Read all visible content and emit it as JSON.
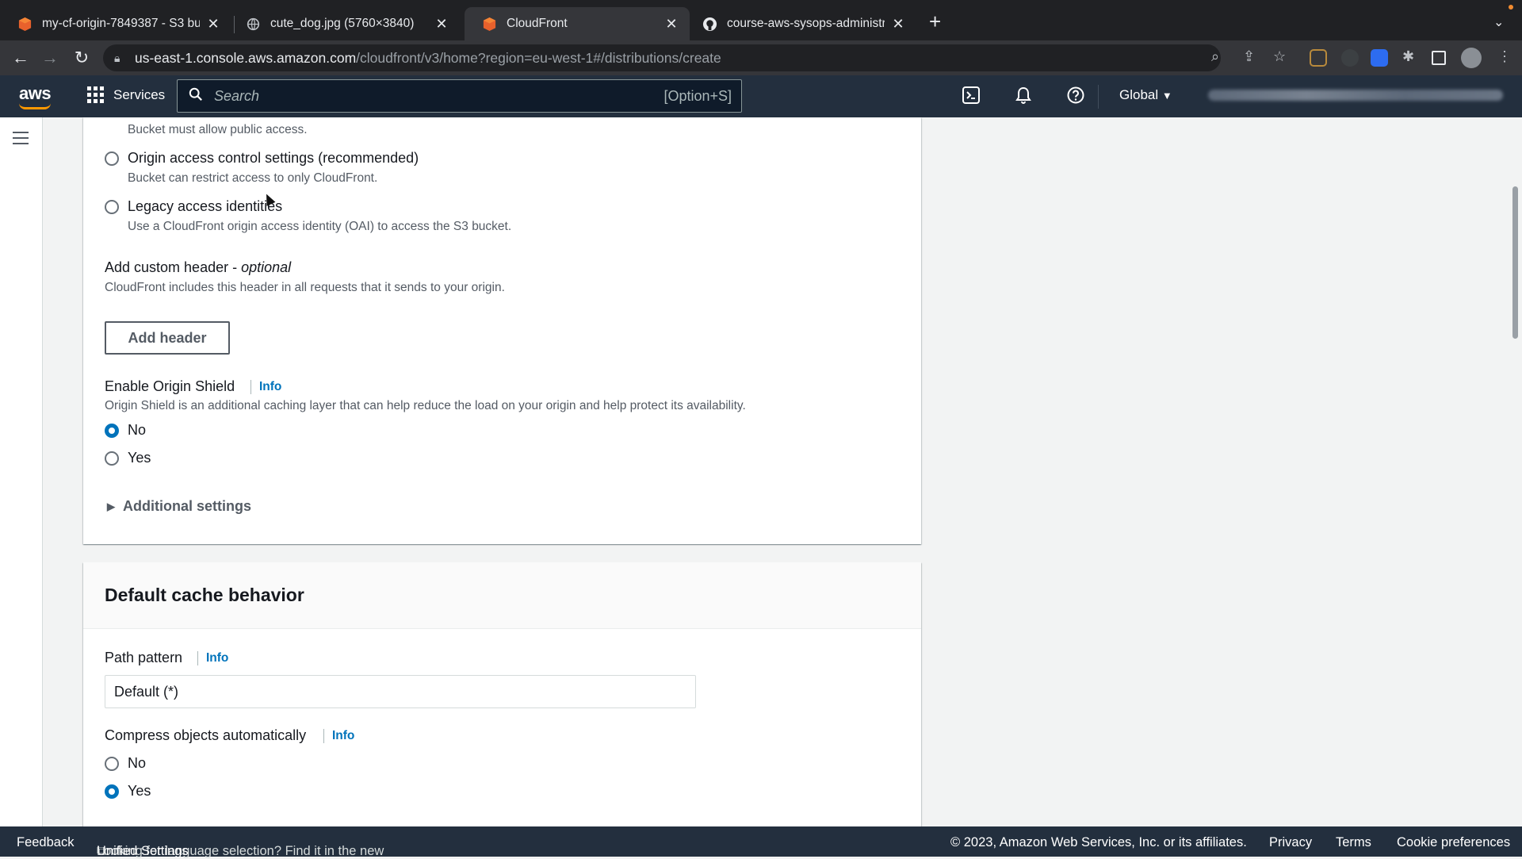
{
  "browser": {
    "tabs": [
      {
        "title": "my-cf-origin-7849387 - S3 bu",
        "icon": "aws-cube-icon"
      },
      {
        "title": "cute_dog.jpg (5760×3840)",
        "icon": "globe-icon"
      },
      {
        "title": "CloudFront",
        "icon": "aws-cube-icon"
      },
      {
        "title": "course-aws-sysops-administr",
        "icon": "github-icon"
      }
    ],
    "url_host": "us-east-1.console.aws.amazon.com",
    "url_path": "/cloudfront/v3/home?region=eu-west-1#/distributions/create"
  },
  "aws_header": {
    "logo": "aws",
    "services_label": "Services",
    "search_placeholder": "Search",
    "search_shortcut": "[Option+S]",
    "region_label": "Global"
  },
  "origin_access": {
    "public_desc": "Bucket must allow public access.",
    "oac_label": "Origin access control settings (recommended)",
    "oac_desc": "Bucket can restrict access to only CloudFront.",
    "legacy_label": "Legacy access identities",
    "legacy_desc": "Use a CloudFront origin access identity (OAI) to access the S3 bucket."
  },
  "custom_header": {
    "title": "Add custom header - ",
    "title_optional": "optional",
    "desc": "CloudFront includes this header in all requests that it sends to your origin.",
    "button": "Add header"
  },
  "origin_shield": {
    "title": "Enable Origin Shield",
    "info": "Info",
    "desc": "Origin Shield is an additional caching layer that can help reduce the load on your origin and help protect its availability.",
    "option_no": "No",
    "option_yes": "Yes",
    "selected": "No"
  },
  "additional_settings": "Additional settings",
  "default_cache": {
    "heading": "Default cache behavior",
    "path_label": "Path pattern",
    "path_info": "Info",
    "path_value": "Default (*)",
    "compress_label": "Compress objects automatically",
    "compress_info": "Info",
    "option_no": "No",
    "option_yes": "Yes",
    "compress_selected": "Yes"
  },
  "footer": {
    "feedback": "Feedback",
    "lang_text": "Looking for language selection? Find it in the new ",
    "unified": "Unified Settings",
    "copyright": "© 2023, Amazon Web Services, Inc. or its affiliates.",
    "privacy": "Privacy",
    "terms": "Terms",
    "cookies": "Cookie preferences"
  },
  "colors": {
    "aws_nav": "#232f3e",
    "accent": "#0073bb",
    "orange": "#ff9900"
  }
}
